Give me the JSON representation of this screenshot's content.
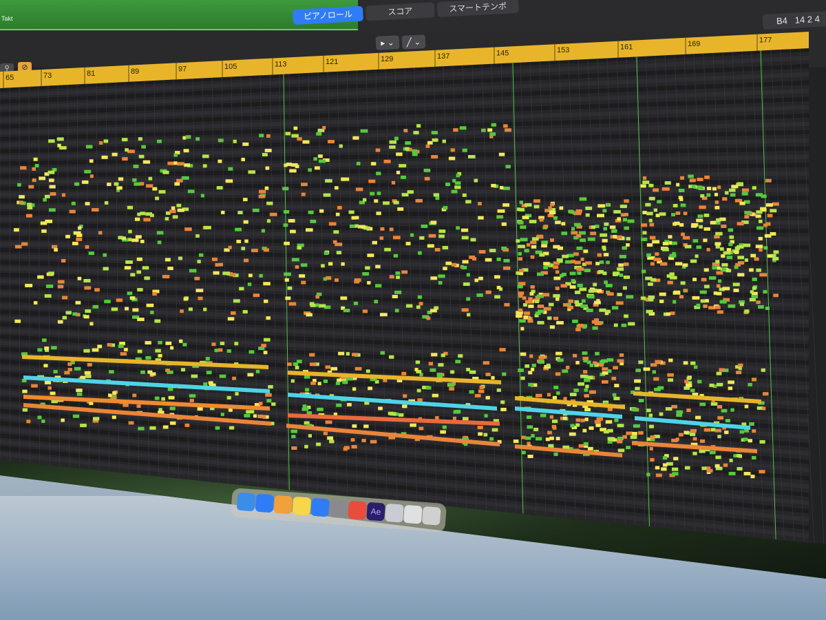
{
  "region": {
    "label": "Takt"
  },
  "view_tabs": [
    {
      "label": "ピアノロール",
      "active": true
    },
    {
      "label": "スコア",
      "active": false
    },
    {
      "label": "スマートテンポ",
      "active": false
    }
  ],
  "position_display": {
    "note": "B4",
    "value": "14 2 4"
  },
  "tools": {
    "pointer": "▸ ⌄",
    "pencil": "╱ ⌄"
  },
  "ruler": {
    "bars": [
      "65",
      "73",
      "81",
      "89",
      "97",
      "105",
      "113",
      "121",
      "129",
      "137",
      "145",
      "153",
      "161",
      "169",
      "177"
    ],
    "color": "#e8b52a"
  },
  "colors": {
    "background": "#222224",
    "grid_dark": "#1d1d20",
    "grid_light": "#2e2e32",
    "accent_blue": "#2f7cf6",
    "note_yellow": "#f2e85a",
    "note_green": "#56c93e",
    "note_orange": "#e9853a",
    "note_cyan": "#4fd3e6"
  },
  "dock": {
    "icons": [
      "finder-icon",
      "safari-icon",
      "photos-icon",
      "notes-icon",
      "app-store-icon",
      "system-settings-icon",
      "chrome-icon",
      "after-effects-icon",
      "disk-utility-icon",
      "downloads-icon",
      "trash-icon"
    ],
    "ae_label": "Ae"
  }
}
